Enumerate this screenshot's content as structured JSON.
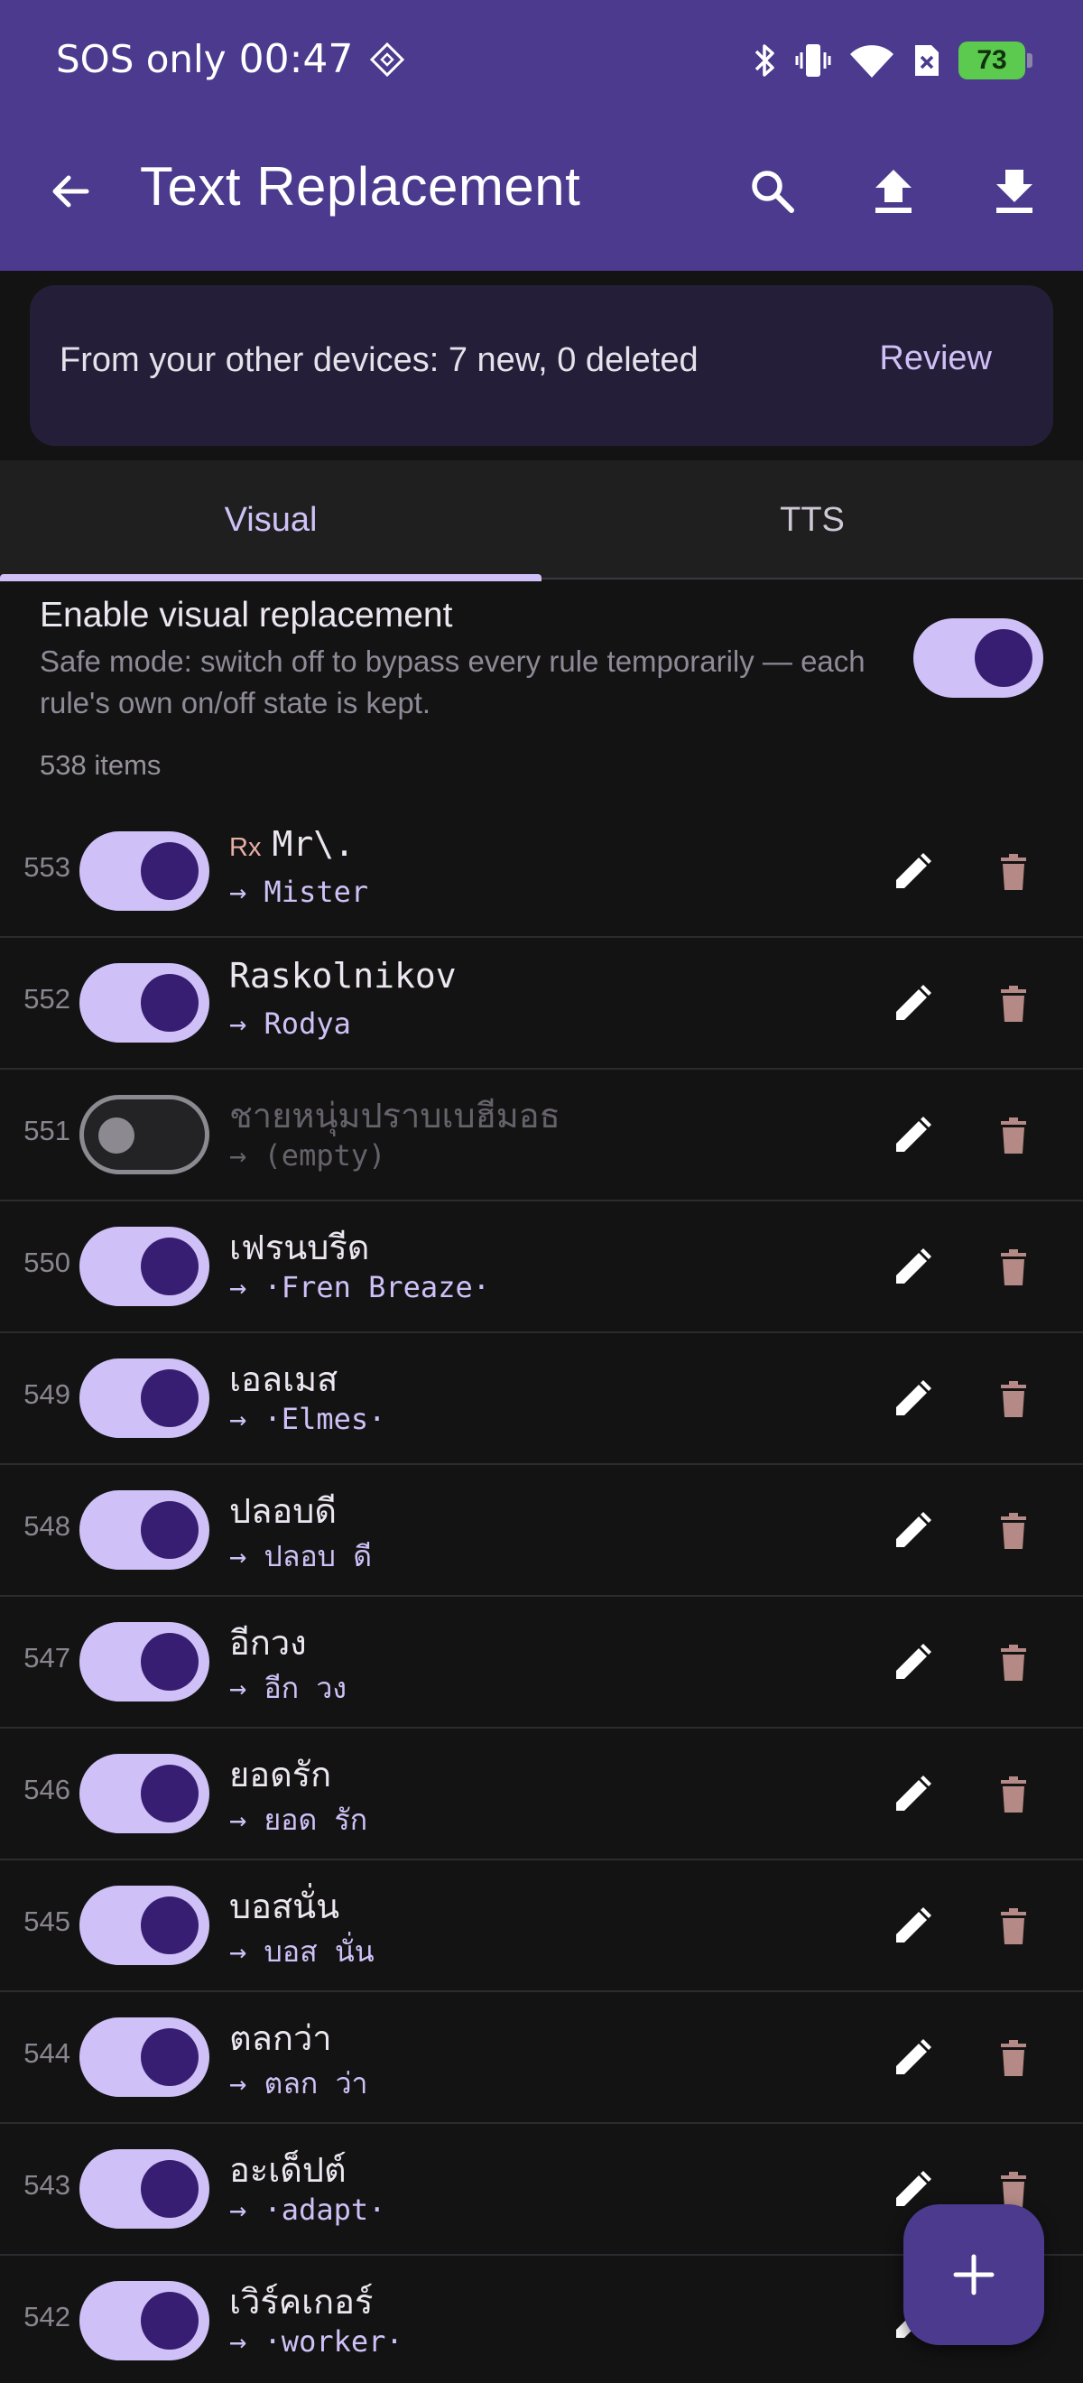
{
  "status_bar": {
    "carrier": "SOS only",
    "time": "00:47",
    "battery": "73"
  },
  "app_bar": {
    "title": "Text Replacement",
    "icons": [
      "back-arrow-icon",
      "search-icon",
      "upload-icon",
      "download-icon"
    ]
  },
  "sync_banner": {
    "text": "From your other devices: 7 new, 0 deleted",
    "action": "Review"
  },
  "tabs": [
    {
      "label": "Visual",
      "selected": true
    },
    {
      "label": "TTS",
      "selected": false
    }
  ],
  "visual_replacement": {
    "title": "Enable visual replacement",
    "description": "Safe mode: switch off to bypass every rule temporarily — each rule's own on/off state is kept.",
    "enabled": true
  },
  "item_count": "538 items",
  "rules": [
    {
      "number": "553",
      "enabled": true,
      "regex": true,
      "regex_label": "Rx",
      "find": "Mr\\.",
      "replace": "→ Mister"
    },
    {
      "number": "552",
      "enabled": true,
      "regex": false,
      "regex_label": "",
      "find": "Raskolnikov",
      "replace": "→ Rodya"
    },
    {
      "number": "551",
      "enabled": false,
      "regex": false,
      "regex_label": "",
      "find": "ชายหนุ่มปราบเบฮีมอธ",
      "replace": "→ (empty)"
    },
    {
      "number": "550",
      "enabled": true,
      "regex": false,
      "regex_label": "",
      "find": "เฟรนบรีด",
      "replace": "→ ·Fren Breaze·"
    },
    {
      "number": "549",
      "enabled": true,
      "regex": false,
      "regex_label": "",
      "find": "เอลเมส",
      "replace": "→ ·Elmes·"
    },
    {
      "number": "548",
      "enabled": true,
      "regex": false,
      "regex_label": "",
      "find": "ปลอบดี",
      "replace": "→ ปลอบ ดี"
    },
    {
      "number": "547",
      "enabled": true,
      "regex": false,
      "regex_label": "",
      "find": "อีกวง",
      "replace": "→ อีก วง"
    },
    {
      "number": "546",
      "enabled": true,
      "regex": false,
      "regex_label": "",
      "find": "ยอดรัก",
      "replace": "→ ยอด รัก"
    },
    {
      "number": "545",
      "enabled": true,
      "regex": false,
      "regex_label": "",
      "find": "บอสนั่น",
      "replace": "→ บอส นั่น"
    },
    {
      "number": "544",
      "enabled": true,
      "regex": false,
      "regex_label": "",
      "find": "ตลกว่า",
      "replace": "→ ตลก ว่า"
    },
    {
      "number": "543",
      "enabled": true,
      "regex": false,
      "regex_label": "",
      "find": "อะเด็ปต์",
      "replace": "→ ·adapt·"
    },
    {
      "number": "542",
      "enabled": true,
      "regex": false,
      "regex_label": "",
      "find": "เวิร์คเกอร์",
      "replace": "→ ·worker·"
    }
  ],
  "fab": {
    "icon": "plus-icon"
  },
  "colors": {
    "app_bar": "#4B3A8D",
    "background": "#131313",
    "accent": "#CFC1F7",
    "switch_knob": "#381E72",
    "banner": "#251E38",
    "battery": "#5CC94F",
    "delete_icon": "#B58A86"
  }
}
